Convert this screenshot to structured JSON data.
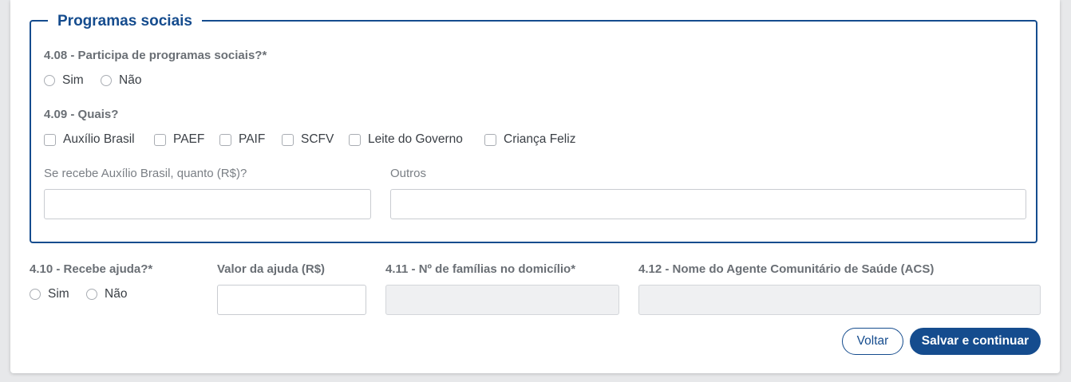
{
  "section": {
    "legend": "Programas sociais",
    "q408": {
      "label": "4.08 - Participa de programas sociais?*",
      "options": [
        "Sim",
        "Não"
      ]
    },
    "q409": {
      "label": "4.09 - Quais?",
      "options": [
        "Auxílio Brasil",
        "PAEF",
        "PAIF",
        "SCFV",
        "Leite do Governo",
        "Criança Feliz"
      ]
    },
    "auxilio_field": {
      "label": "Se recebe Auxílio Brasil, quanto (R$)?",
      "value": ""
    },
    "outros_field": {
      "label": "Outros",
      "value": ""
    }
  },
  "q410": {
    "label": "4.10 - Recebe ajuda?*",
    "options": [
      "Sim",
      "Não"
    ]
  },
  "valor_ajuda": {
    "label": "Valor da ajuda (R$)",
    "value": ""
  },
  "q411": {
    "label": "4.11 - Nº de famílias no domicílio*",
    "value": ""
  },
  "q412": {
    "label": "4.12 - Nome do Agente Comunitário de Saúde (ACS)",
    "value": ""
  },
  "buttons": {
    "back": "Voltar",
    "save": "Salvar e continuar"
  },
  "colors": {
    "primary": "#154c8e",
    "label": "#6a6f75",
    "disabled_bg": "#eff0f2"
  }
}
